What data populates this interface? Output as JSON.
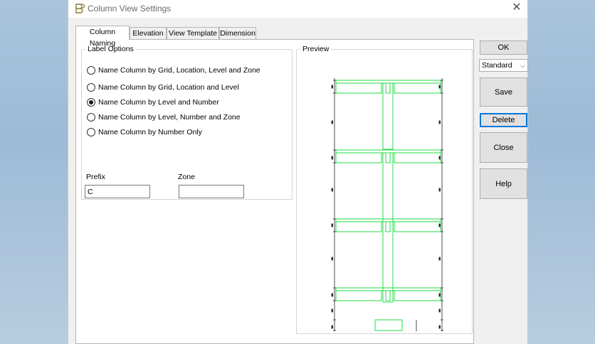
{
  "window": {
    "title": "Column View Settings",
    "close_symbol": "✕"
  },
  "tabs": [
    {
      "label": "Column Naming",
      "active": true
    },
    {
      "label": "Elevation",
      "active": false
    },
    {
      "label": "View Template",
      "active": false
    },
    {
      "label": "Dimension",
      "active": false
    }
  ],
  "label_options": {
    "legend": "Label Options",
    "options": [
      {
        "label": "Name Column by Grid, Location, Level and Zone",
        "selected": false
      },
      {
        "label": "Name Column by Grid, Location and Level",
        "selected": false
      },
      {
        "label": "Name Column by Level and Number",
        "selected": true
      },
      {
        "label": "Name Column by Level, Number and Zone",
        "selected": false
      },
      {
        "label": "Name Column by Number Only",
        "selected": false
      }
    ]
  },
  "prefix": {
    "label": "Prefix",
    "value": "C"
  },
  "zone": {
    "label": "Zone",
    "value": ""
  },
  "preview": {
    "legend": "Preview",
    "line_color": "#22dd44"
  },
  "buttons": {
    "ok": "OK",
    "template_select": "Standard",
    "save": "Save",
    "delete": "Delete",
    "close": "Close",
    "help": "Help"
  }
}
